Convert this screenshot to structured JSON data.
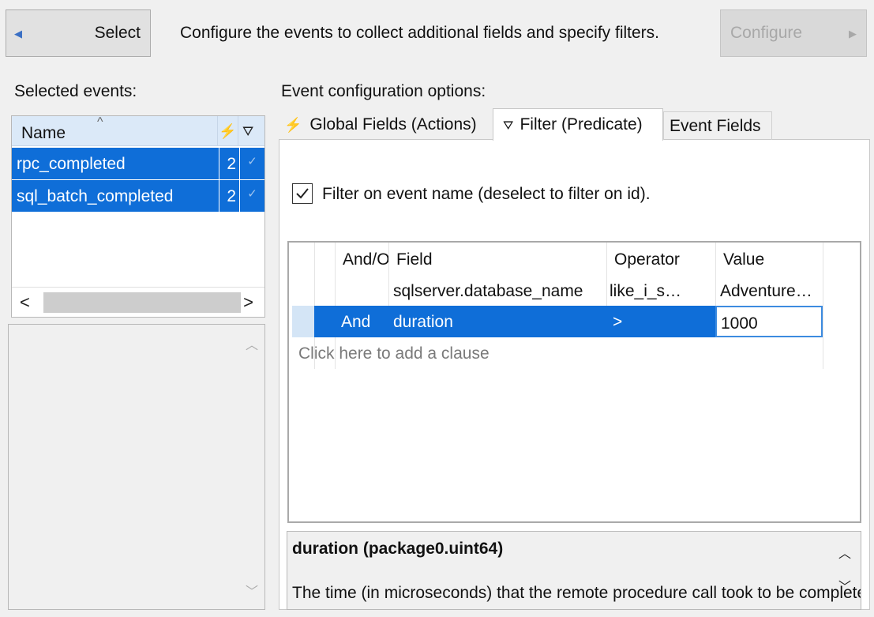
{
  "toolbar": {
    "select_label": "Select",
    "instruction": "Configure the events to collect additional fields and specify filters.",
    "configure_label": "Configure"
  },
  "selected_events": {
    "label": "Selected events:",
    "column_name": "Name",
    "rows": [
      {
        "name": "rpc_completed",
        "count": "2",
        "filter": "✓"
      },
      {
        "name": "sql_batch_completed",
        "count": "2",
        "filter": "✓"
      }
    ]
  },
  "options": {
    "label": "Event configuration options:",
    "tabs": [
      "Global Fields (Actions)",
      "Filter (Predicate)",
      "Event Fields"
    ],
    "filter_on_name_label": "Filter on event name (deselect to filter on id).",
    "filter_on_name_checked": true
  },
  "grid": {
    "headers": {
      "andor": "And/Or",
      "field": "Field",
      "operator": "Operator",
      "value": "Value"
    },
    "rows": [
      {
        "andor": "",
        "field": "sqlserver.database_name",
        "operator": "like_i_sql_unicode_string",
        "value": "AdventureWorks"
      },
      {
        "andor": "And",
        "field": "duration",
        "operator": ">",
        "value": "1000"
      }
    ],
    "add_clause": "Click here to add a clause"
  },
  "description": {
    "title": "duration (package0.uint64)",
    "text": "The time (in microseconds) that the remote procedure call took to be completed."
  },
  "colors": {
    "selection": "#0f6ed8",
    "header": "#dbe9f8",
    "bolt": "#d9a400"
  }
}
